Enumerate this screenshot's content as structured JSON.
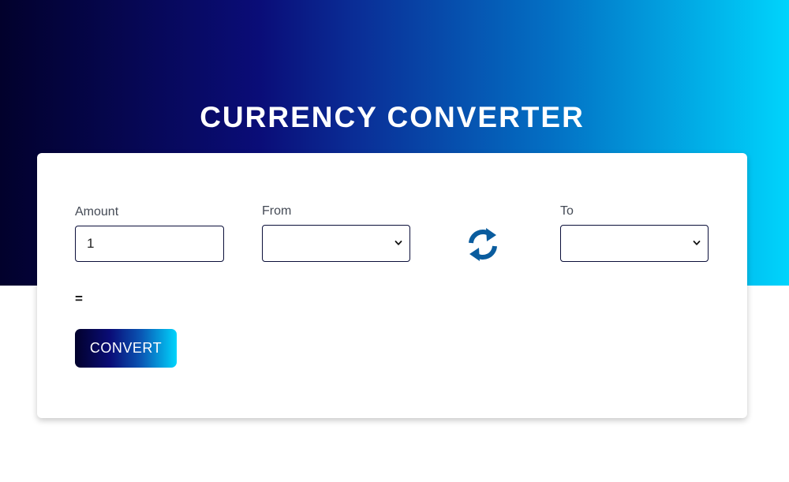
{
  "header": {
    "title": "CURRENCY CONVERTER"
  },
  "form": {
    "amount_label": "Amount",
    "amount_value": "1",
    "from_label": "From",
    "from_selected": "",
    "to_label": "To",
    "to_selected": "",
    "swap_icon": "swap-arrows-icon",
    "result_text": "=",
    "convert_label": "CONVERT"
  },
  "colors": {
    "gradient_start": "#02012c",
    "gradient_mid": "#0a0d78",
    "gradient_end": "#00d4fc",
    "swap_icon": "#0a5c9e"
  }
}
